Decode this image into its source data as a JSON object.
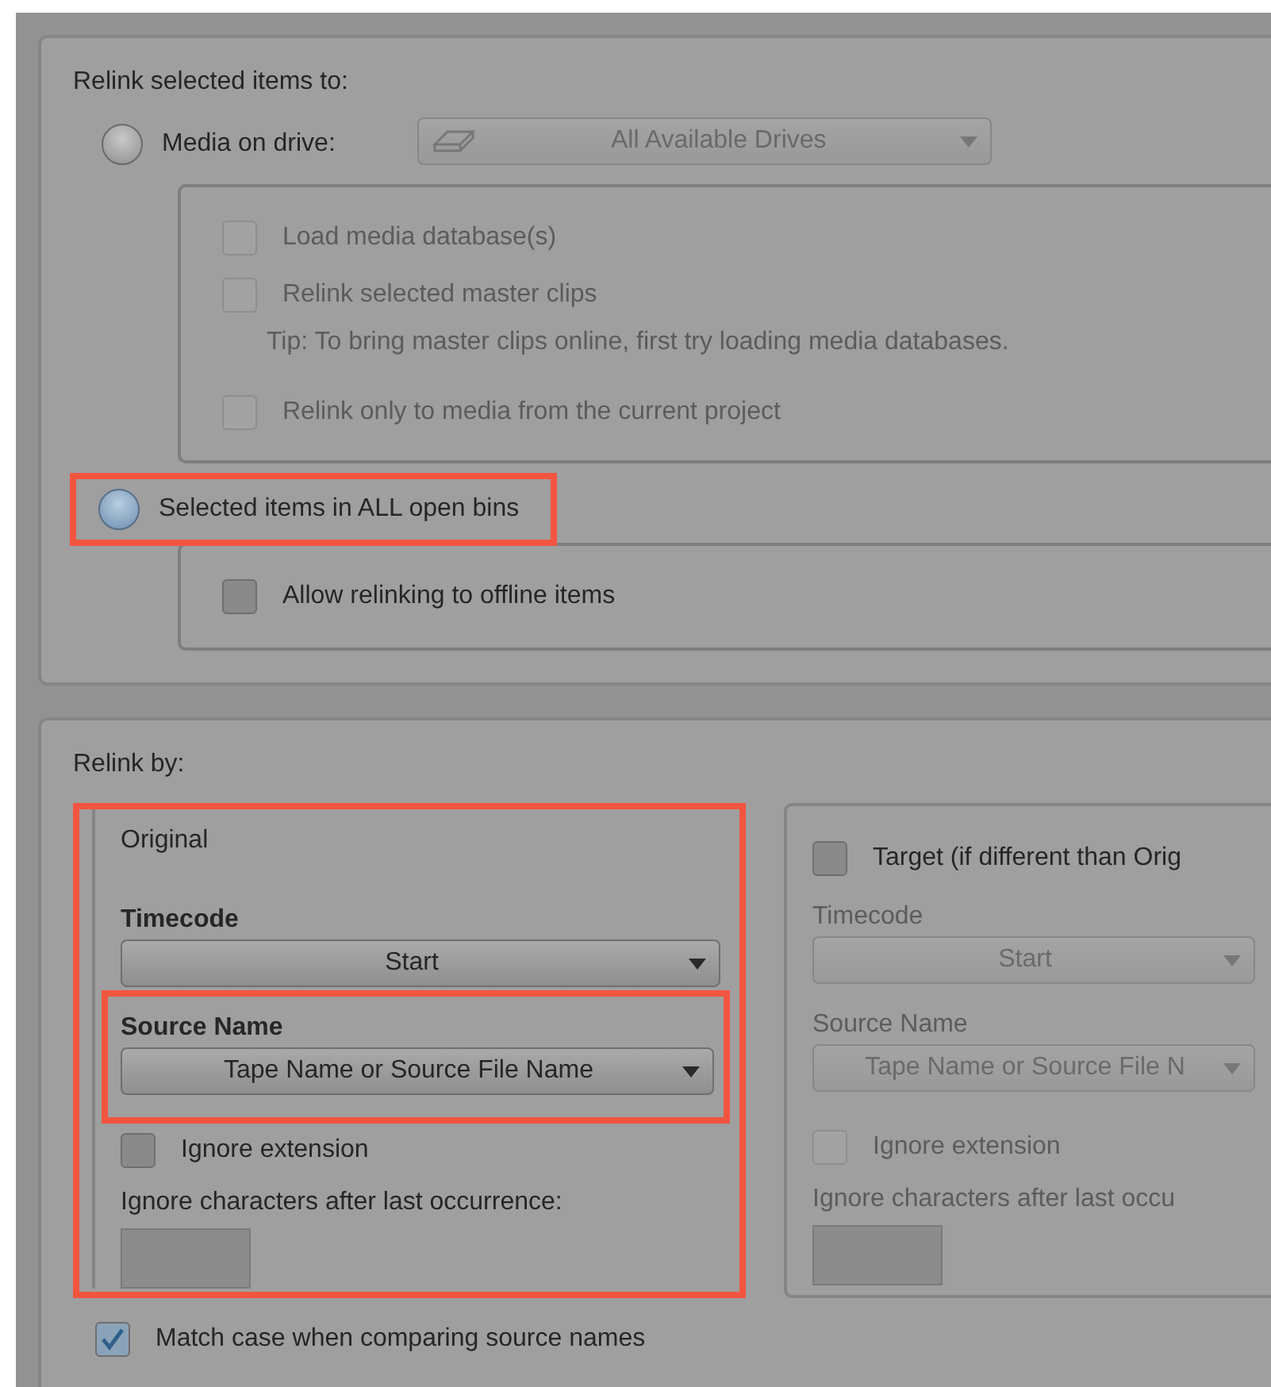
{
  "relink_to": {
    "title": "Relink selected items to:",
    "options": [
      {
        "label": "Media on drive:",
        "selected": false,
        "highlighted": false,
        "dropdown": {
          "value": "All Available Drives",
          "disabled": true
        },
        "sub_items": [
          {
            "kind": "checkbox",
            "label": "Load media database(s)",
            "checked": false,
            "disabled": true
          },
          {
            "kind": "checkbox",
            "label": "Relink selected master clips",
            "checked": false,
            "disabled": true
          },
          {
            "kind": "tip",
            "text": "Tip: To bring master clips online, first try loading media databases."
          },
          {
            "kind": "checkbox",
            "label": "Relink only to media from the current project",
            "checked": false,
            "disabled": true
          }
        ]
      },
      {
        "label": "Selected items in ALL open bins",
        "selected": true,
        "highlighted": true,
        "sub_items": [
          {
            "kind": "checkbox",
            "label": "Allow relinking to offline items",
            "checked": false,
            "disabled": false
          }
        ]
      }
    ]
  },
  "relink_by": {
    "title": "Relink by:",
    "groups": [
      {
        "kind": "title",
        "title": "Original",
        "highlighted": true,
        "disabled": false,
        "timecode_label": "Timecode",
        "timecode": "Start",
        "source_name_label": "Source Name",
        "source_name": "Tape Name or Source File Name",
        "source_name_highlighted": true,
        "ignore_extension": {
          "label": "Ignore extension",
          "checked": false
        },
        "ignore_after_label": "Ignore characters after last occurrence:"
      },
      {
        "kind": "checkbox",
        "title": "Target (if different than Orig",
        "checked": false,
        "highlighted": false,
        "disabled": true,
        "timecode_label": "Timecode",
        "timecode": "Start",
        "source_name_label": "Source Name",
        "source_name": "Tape Name or Source File N",
        "source_name_highlighted": false,
        "ignore_extension": {
          "label": "Ignore extension",
          "checked": false
        },
        "ignore_after_label": "Ignore characters after last occu"
      }
    ]
  },
  "match_case": {
    "label": "Match case when comparing source names",
    "checked": true
  }
}
